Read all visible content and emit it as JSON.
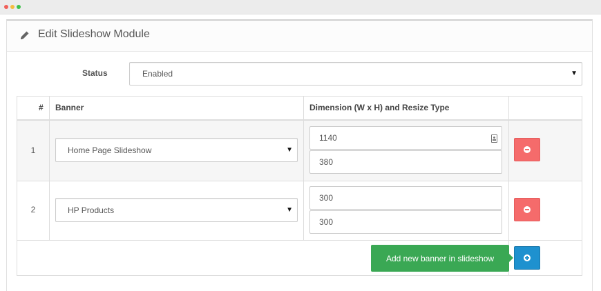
{
  "panel": {
    "title": "Edit Slideshow Module",
    "title_icon": "pencil-icon"
  },
  "status": {
    "label": "Status",
    "selected": "Enabled"
  },
  "table": {
    "headers": [
      "#",
      "Banner",
      "Dimension (W x H) and Resize Type"
    ],
    "rows": [
      {
        "index": "1",
        "banner": "Home Page Slideshow",
        "width": "1140",
        "height": "380"
      },
      {
        "index": "2",
        "banner": "HP Products",
        "width": "300",
        "height": "300"
      }
    ]
  },
  "tooltip": {
    "add_banner": "Add new banner in slideshow"
  },
  "colors": {
    "danger": "#f56b6b",
    "primary": "#1e91cf",
    "success_tooltip": "#3aa854"
  }
}
